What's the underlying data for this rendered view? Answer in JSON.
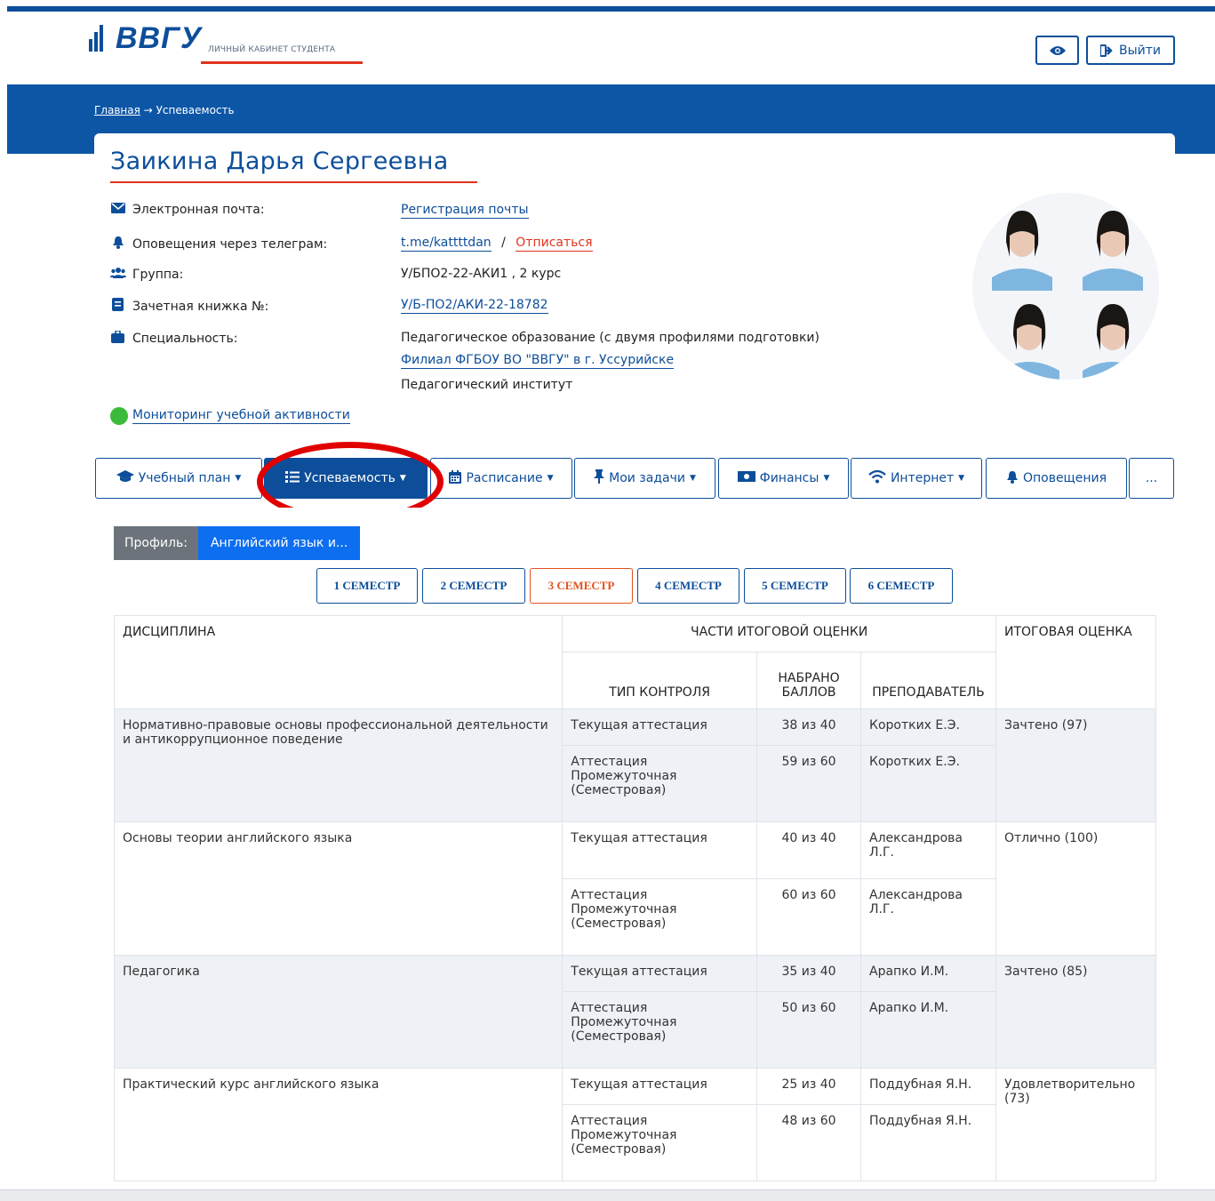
{
  "colors": {
    "brand": "#0d4e9a",
    "accent": "#e0341e",
    "status_ok": "#3bbb3b"
  },
  "header": {
    "logo_text": "ВВГУ",
    "cabinet_label": "ЛИЧНЫЙ КАБИНЕТ СТУДЕНТА",
    "view_icon": "eye-icon",
    "logout_label": "Выйти"
  },
  "breadcrumb": {
    "home": "Главная",
    "separator": "→",
    "current": "Успеваемость"
  },
  "student": {
    "name": "Заикина Дарья Сергеевна",
    "email": {
      "label": "Электронная почта:",
      "value": "Регистрация почты"
    },
    "telegram": {
      "label": "Оповещения через телеграм:",
      "value": "t.me/kattttdan",
      "separator": "/",
      "unsubscribe": "Отписаться"
    },
    "group": {
      "label": "Группа:",
      "value": "У/БПО2-22-АКИ1 , 2 курс"
    },
    "record_book": {
      "label": "Зачетная книжка №:",
      "value": "У/Б-ПО2/АКИ-22-18782"
    },
    "specialty": {
      "label": "Специальность:",
      "value": "Педагогическое образование (с двумя профилями подготовки)",
      "branch": "Филиал ФГБОУ ВО \"ВВГУ\" в г. Уссурийске",
      "institute": "Педагогический институт"
    },
    "monitoring": "Мониторинг учебной активности"
  },
  "tabs": [
    {
      "icon": "graduation-cap-icon",
      "label": "Учебный план"
    },
    {
      "icon": "list-icon",
      "label": "Успеваемость"
    },
    {
      "icon": "calendar-icon",
      "label": "Расписание"
    },
    {
      "icon": "pin-icon",
      "label": "Мои задачи"
    },
    {
      "icon": "money-icon",
      "label": "Финансы"
    },
    {
      "icon": "wifi-icon",
      "label": "Интернет"
    },
    {
      "icon": "bell-icon",
      "label": "Оповещения"
    },
    {
      "icon": "",
      "label": "..."
    }
  ],
  "profile": {
    "label": "Профиль:",
    "value": "Английский язык и..."
  },
  "semesters": [
    "1 СЕМЕСТР",
    "2 СЕМЕСТР",
    "3 СЕМЕСТР",
    "4 СЕМЕСТР",
    "5 СЕМЕСТР",
    "6 СЕМЕСТР"
  ],
  "active_semester": "3 СЕМЕСТР",
  "table": {
    "headers": {
      "discipline": "ДИСЦИПЛИНА",
      "parts": "ЧАСТИ ИТОГОВОЙ ОЦЕНКИ",
      "final": "ИТОГОВАЯ ОЦЕНКА",
      "control_type": "ТИП КОНТРОЛЯ",
      "score": "НАБРАНО БАЛЛОВ",
      "teacher": "ПРЕПОДАВАТЕЛЬ"
    },
    "rows": [
      {
        "discipline": "Нормативно-правовые основы профессиональной деятельности и антикоррупционное поведение",
        "final": "Зачтено (97)",
        "parts": [
          {
            "type": "Текущая аттестация",
            "score": "38 из 40",
            "teacher": "Коротких Е.Э."
          },
          {
            "type": "Аттестация Промежуточная (Семестровая)",
            "score": "59 из 60",
            "teacher": "Коротких Е.Э."
          }
        ]
      },
      {
        "discipline": "Основы теории английского языка",
        "final": "Отлично (100)",
        "parts": [
          {
            "type": "Текущая аттестация",
            "score": "40 из 40",
            "teacher": "Александрова Л.Г."
          },
          {
            "type": "Аттестация Промежуточная (Семестровая)",
            "score": "60 из 60",
            "teacher": "Александрова Л.Г."
          }
        ]
      },
      {
        "discipline": "Педагогика",
        "final": "Зачтено (85)",
        "parts": [
          {
            "type": "Текущая аттестация",
            "score": "35 из 40",
            "teacher": "Арапко И.М."
          },
          {
            "type": "Аттестация Промежуточная (Семестровая)",
            "score": "50 из 60",
            "teacher": "Арапко И.М."
          }
        ]
      },
      {
        "discipline": "Практический курс английского языка",
        "final": "Удовлетворительно (73)",
        "parts": [
          {
            "type": "Текущая аттестация",
            "score": "25 из 40",
            "teacher": "Поддубная Я.Н."
          },
          {
            "type": "Аттестация Промежуточная (Семестровая)",
            "score": "48 из 60",
            "teacher": "Поддубная Я.Н."
          }
        ]
      }
    ]
  }
}
